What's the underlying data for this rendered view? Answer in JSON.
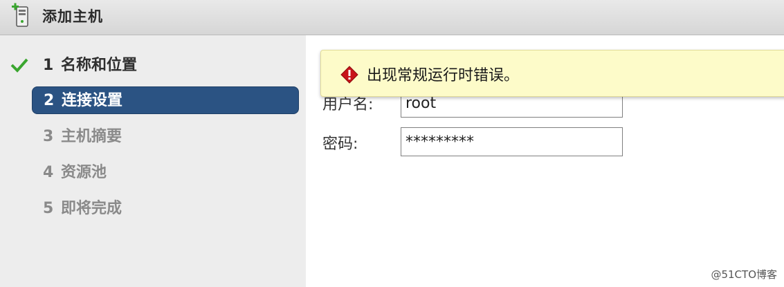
{
  "window": {
    "title": "添加主机"
  },
  "steps": [
    {
      "num": "1",
      "label": "名称和位置",
      "state": "done"
    },
    {
      "num": "2",
      "label": "连接设置",
      "state": "active"
    },
    {
      "num": "3",
      "label": "主机摘要",
      "state": "pending"
    },
    {
      "num": "4",
      "label": "资源池",
      "state": "pending"
    },
    {
      "num": "5",
      "label": "即将完成",
      "state": "pending"
    }
  ],
  "error": {
    "message": "出现常规运行时错误。"
  },
  "form": {
    "username_label": "用户名:",
    "username_value": "root",
    "password_label": "密码:",
    "password_value": "*********"
  },
  "watermark": "@51CTO博客",
  "colors": {
    "active_step": "#2b5383",
    "error_bg": "#fdfbc9",
    "check": "#3aa62f"
  }
}
